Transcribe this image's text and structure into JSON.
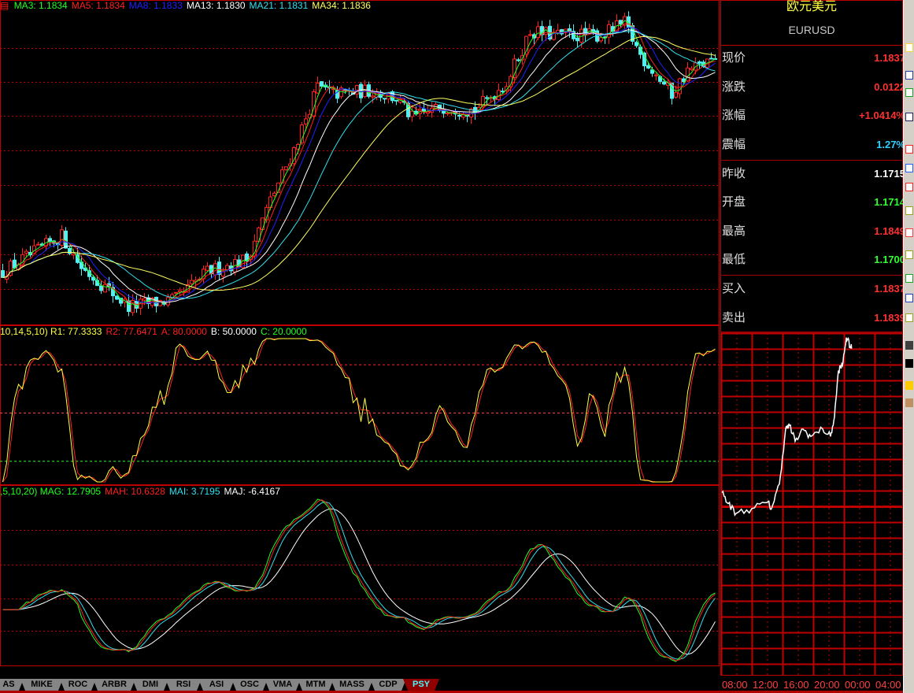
{
  "main_legend": [
    {
      "label": "MA3: 1.1834",
      "color": "#20ff20"
    },
    {
      "label": "MA5: 1.1834",
      "color": "#ff2020"
    },
    {
      "label": "MA8: 1.1833",
      "color": "#2020ff"
    },
    {
      "label": "MA13: 1.1830",
      "color": "#ffffff"
    },
    {
      "label": "MA21: 1.1831",
      "color": "#30e0f0"
    },
    {
      "label": "MA34: 1.1836",
      "color": "#ffff60"
    }
  ],
  "psy_legend": [
    {
      "label": "10,14,5,10) R1: 77.3333",
      "color": "#ffff40"
    },
    {
      "label": "R2: 77.6471",
      "color": "#ff2020"
    },
    {
      "label": "A: 80.0000",
      "color": "#ff2020"
    },
    {
      "label": "B: 50.0000",
      "color": "#ffffff"
    },
    {
      "label": "C: 20.0000",
      "color": "#20ff20"
    }
  ],
  "mag_legend": [
    {
      "label": ",5,10,20) MAG: 12.7905",
      "color": "#20ff20"
    },
    {
      "label": "MAH: 10.6328",
      "color": "#ff2020"
    },
    {
      "label": "MAI: 3.7195",
      "color": "#30e0f0"
    },
    {
      "label": "MAJ: -6.4167",
      "color": "#ffffff"
    }
  ],
  "quote": {
    "name": "欧元美元",
    "symbol": "EURUSD",
    "rows": [
      {
        "label": "现价",
        "value": "1.1837",
        "color": "#ff3030"
      },
      {
        "label": "涨跌",
        "value": "0.0122",
        "color": "#ff3030"
      },
      {
        "label": "涨幅",
        "value": "+1.0414%",
        "color": "#ff3030"
      },
      {
        "label": "震幅",
        "value": "1.27%",
        "color": "#30d0ff"
      },
      {
        "label": "昨收",
        "value": "1.1715",
        "color": "#ffffff"
      },
      {
        "label": "开盘",
        "value": "1.1714",
        "color": "#30ff30"
      },
      {
        "label": "最高",
        "value": "1.1849",
        "color": "#ff3030"
      },
      {
        "label": "最低",
        "value": "1.1700",
        "color": "#30ff30"
      },
      {
        "label": "买入",
        "value": "1.1837",
        "color": "#ff3030"
      },
      {
        "label": "卖出",
        "value": "1.1839",
        "color": "#ff3030"
      }
    ]
  },
  "intraday": {
    "time_labels": [
      "08:00",
      "12:00",
      "16:00",
      "20:00",
      "00:00",
      "04:00"
    ],
    "price_range": [
      1.17,
      1.1849
    ],
    "minutes_total": 1440,
    "points": [
      {
        "t": 0,
        "p": 1.1719
      },
      {
        "t": 49,
        "p": 1.171
      },
      {
        "t": 111,
        "p": 1.1702
      },
      {
        "t": 234,
        "p": 1.1706
      },
      {
        "t": 357,
        "p": 1.1711
      },
      {
        "t": 388,
        "p": 1.1706
      },
      {
        "t": 449,
        "p": 1.1726
      },
      {
        "t": 498,
        "p": 1.1771
      },
      {
        "t": 529,
        "p": 1.1774
      },
      {
        "t": 572,
        "p": 1.1761
      },
      {
        "t": 634,
        "p": 1.1771
      },
      {
        "t": 695,
        "p": 1.1765
      },
      {
        "t": 788,
        "p": 1.1771
      },
      {
        "t": 849,
        "p": 1.1765
      },
      {
        "t": 880,
        "p": 1.1781
      },
      {
        "t": 911,
        "p": 1.1819
      },
      {
        "t": 942,
        "p": 1.1823
      },
      {
        "t": 972,
        "p": 1.1846
      },
      {
        "t": 1003,
        "p": 1.1839
      },
      {
        "t": 1015,
        "p": 1.1837
      }
    ]
  },
  "tabs": [
    "AS",
    "MIKE",
    "ROC",
    "ARBR",
    "DMI",
    "RSI",
    "ASI",
    "OSC",
    "VMA",
    "MTM",
    "MASS",
    "CDP",
    "PSY"
  ],
  "active_tab": "PSY",
  "chart_data": {
    "type": "candlestick",
    "symbol": "EURUSD",
    "candle_count": 182,
    "ylim": [
      1.154,
      1.1891
    ],
    "price_path_anchors": [
      {
        "i": 0,
        "p": 1.1599
      },
      {
        "i": 15,
        "p": 1.1639
      },
      {
        "i": 20,
        "p": 1.1604
      },
      {
        "i": 32,
        "p": 1.156
      },
      {
        "i": 44,
        "p": 1.1568
      },
      {
        "i": 52,
        "p": 1.1599
      },
      {
        "i": 62,
        "p": 1.1613
      },
      {
        "i": 68,
        "p": 1.1679
      },
      {
        "i": 74,
        "p": 1.1736
      },
      {
        "i": 80,
        "p": 1.1806
      },
      {
        "i": 84,
        "p": 1.1798
      },
      {
        "i": 94,
        "p": 1.1802
      },
      {
        "i": 100,
        "p": 1.1793
      },
      {
        "i": 104,
        "p": 1.1771
      },
      {
        "i": 112,
        "p": 1.1784
      },
      {
        "i": 120,
        "p": 1.178
      },
      {
        "i": 128,
        "p": 1.1811
      },
      {
        "i": 134,
        "p": 1.1868
      },
      {
        "i": 140,
        "p": 1.1864
      },
      {
        "i": 152,
        "p": 1.1864
      },
      {
        "i": 158,
        "p": 1.1877
      },
      {
        "i": 162,
        "p": 1.1842
      },
      {
        "i": 170,
        "p": 1.1798
      },
      {
        "i": 174,
        "p": 1.1824
      },
      {
        "i": 181,
        "p": 1.1837
      }
    ],
    "moving_averages": [
      3,
      5,
      8,
      13,
      21,
      34
    ],
    "oscillator_levels": {
      "A": 80,
      "B": 50,
      "C": 20
    }
  },
  "colors": {
    "up": "#ff2020",
    "down": "#50f0f0",
    "grid": "#c00000",
    "border": "#c00000"
  }
}
